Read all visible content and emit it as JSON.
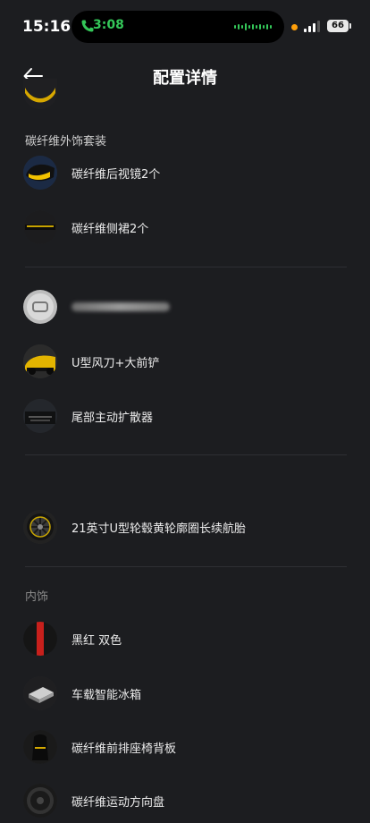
{
  "status": {
    "time": "15:16",
    "call_time": "3:08",
    "battery": "66"
  },
  "header": {
    "title": "配置详情"
  },
  "sections": {
    "exterior_kit": "碳纤维外饰套装",
    "interior": "内饰"
  },
  "items": {
    "mirror": "碳纤维后视镜2个",
    "skirt": "碳纤维侧裙2个",
    "wing": "U型风刀+大前铲",
    "diffuser": "尾部主动扩散器",
    "wheel": "21英寸U型轮毂黄轮廓圈长续航胎",
    "color": "黑红 双色",
    "fridge": "车载智能冰箱",
    "seat": "碳纤维前排座椅背板",
    "steering": "碳纤维运动方向盘"
  },
  "colors": {
    "accent_yellow": "#f2c200",
    "call_green": "#34c759",
    "red": "#c8201c"
  }
}
